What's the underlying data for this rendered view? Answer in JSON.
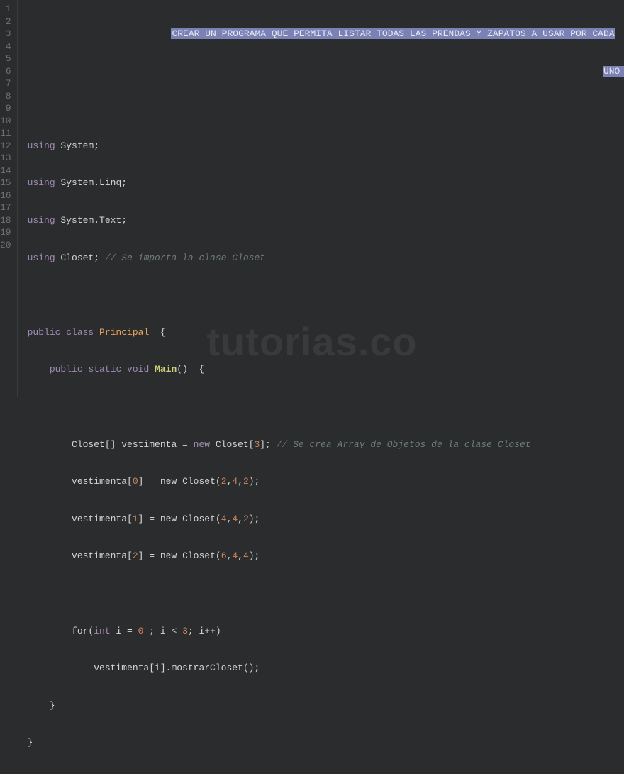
{
  "gutter": {
    "start": 1,
    "end": 20
  },
  "header_comment": {
    "line1": "CREAR UN PROGRAMA QUE PERMITA LISTAR TODAS LAS PRENDAS Y ZAPATOS A USAR POR CADA",
    "line2": "UNO DE TRES CLOSET"
  },
  "code": {
    "using1_kw": "using",
    "using1_ns": " System;",
    "using2_kw": "using",
    "using2_ns": " System.Linq;",
    "using3_kw": "using",
    "using3_ns": " System.Text;",
    "using4_kw": "using",
    "using4_ns": " Closet; ",
    "using4_cmt": "// Se importa la clase Closet",
    "classline_pub": "public ",
    "classline_cls": "class ",
    "classline_name": "Principal",
    "classline_brace": "  {",
    "mainline_pub": "    public ",
    "mainline_static": "static ",
    "mainline_void": "void ",
    "mainline_fn": "Main",
    "mainline_rest": "()  {",
    "arr_decl_pre": "        Closet[] vestimenta = ",
    "arr_decl_new": "new",
    "arr_decl_post1": " Closet[",
    "arr_decl_n": "3",
    "arr_decl_post2": "]; ",
    "arr_decl_cmt": "// Se crea Array de Objetos de la clase Closet",
    "a0_pre": "        vestimenta[",
    "a0_i": "0",
    "a0_mid": "] = new Closet(",
    "a0_v1": "2",
    "a0_c1": ",",
    "a0_v2": "4",
    "a0_c2": ",",
    "a0_v3": "2",
    "a0_end": ");",
    "a1_pre": "        vestimenta[",
    "a1_i": "1",
    "a1_mid": "] = new Closet(",
    "a1_v1": "4",
    "a1_c1": ",",
    "a1_v2": "4",
    "a1_c2": ",",
    "a1_v3": "2",
    "a1_end": ");",
    "a2_pre": "        vestimenta[",
    "a2_i": "2",
    "a2_mid": "] = new Closet(",
    "a2_v1": "6",
    "a2_c1": ",",
    "a2_v2": "4",
    "a2_c2": ",",
    "a2_v3": "4",
    "a2_end": ");",
    "for_pre": "        for(",
    "for_int": "int",
    "for_mid1": " i = ",
    "for_zero": "0",
    "for_mid2": " ; i < ",
    "for_three": "3",
    "for_end": "; i++)",
    "call": "            vestimenta[i].mostrarCloset();",
    "brace1": "    }",
    "brace2": "}"
  },
  "watermark": "tutorias.co"
}
